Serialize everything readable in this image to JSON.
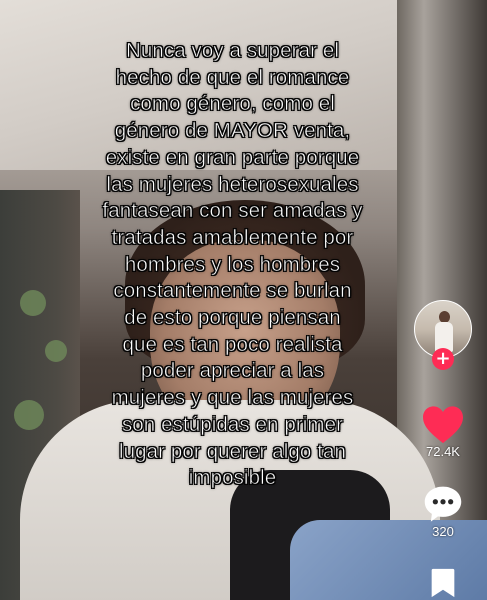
{
  "caption": {
    "lines": [
      "Nunca voy a superar el",
      "hecho de que el romance",
      "como género, como el",
      "género de MAYOR venta,",
      "existe en gran parte porque",
      "las mujeres heterosexuales",
      "fantasean con ser amadas y",
      "tratadas amablemente por",
      "hombres y los hombres",
      "constantemente se burlan",
      "de esto porque piensan",
      "que es tan poco realista",
      "poder apreciar a las",
      "mujeres y que las mujeres",
      "son estúpidas en primer",
      "lugar por querer algo tan",
      "imposible"
    ]
  },
  "actions": {
    "follow_symbol": "+",
    "like_count": "72.4K",
    "comment_count": "320"
  },
  "icons": {
    "like": "heart-icon",
    "comment": "comment-bubble-icon",
    "bookmark": "bookmark-icon",
    "follow": "plus-icon"
  },
  "colors": {
    "like": "#fe2c55",
    "follow": "#fe2c55",
    "caption_text": "#ffffff"
  }
}
